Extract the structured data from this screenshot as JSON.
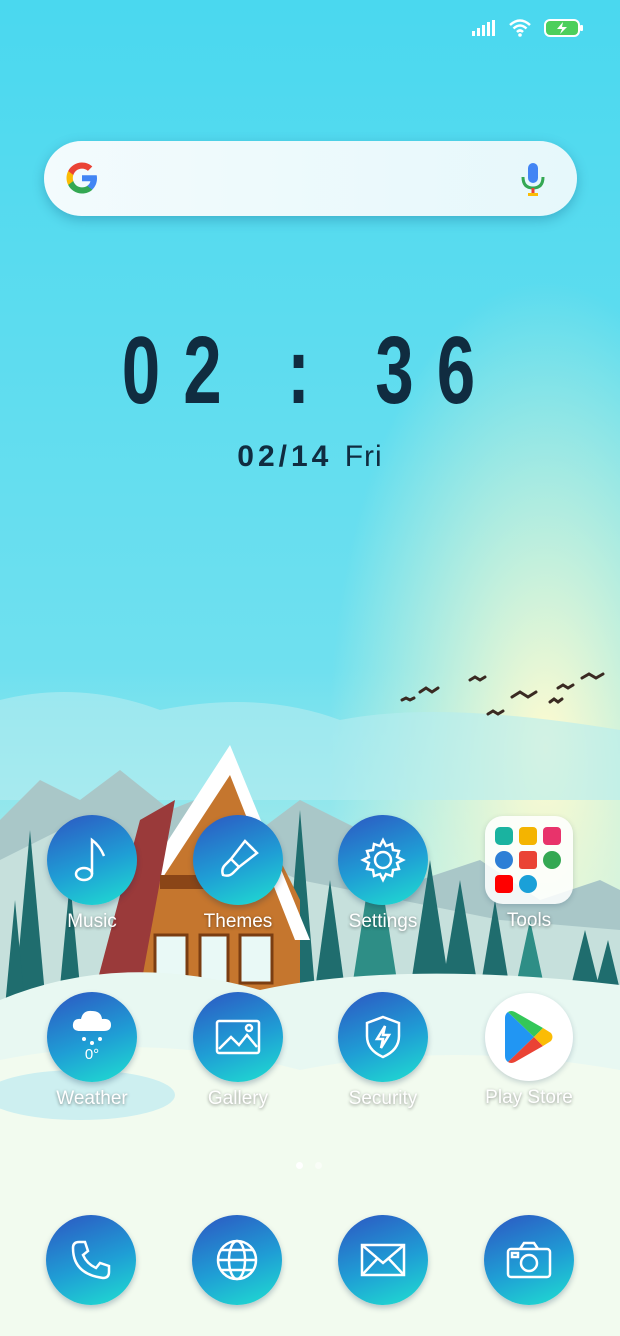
{
  "clock": {
    "time": "02:36",
    "date_num": "02/14",
    "day": "Fri"
  },
  "status": {
    "signal": "signal-bars-icon",
    "wifi": "wifi-icon",
    "battery": "battery-charging-icon"
  },
  "search": {
    "logo": "google-g-icon",
    "mic": "microphone-icon"
  },
  "apps": [
    {
      "label": "Music",
      "icon": "music-note-icon"
    },
    {
      "label": "Themes",
      "icon": "paintbrush-icon"
    },
    {
      "label": "Settings",
      "icon": "gear-icon"
    },
    {
      "label": "Tools",
      "icon": "folder-icon"
    },
    {
      "label": "Weather",
      "icon": "cloud-snow-icon",
      "temp": "0°"
    },
    {
      "label": "Gallery",
      "icon": "image-icon"
    },
    {
      "label": "Security",
      "icon": "shield-bolt-icon"
    },
    {
      "label": "Play Store",
      "icon": "play-store-icon"
    }
  ],
  "dock": [
    {
      "name": "phone",
      "icon": "phone-icon"
    },
    {
      "name": "browser",
      "icon": "globe-icon"
    },
    {
      "name": "messages",
      "icon": "envelope-icon"
    },
    {
      "name": "camera",
      "icon": "camera-icon"
    }
  ],
  "pages": {
    "count": 2,
    "current": 1
  },
  "colors": {
    "sky": "#4fd9ee",
    "clock_text": "#102c40",
    "icon_gradient_top": "#2d56c2",
    "icon_gradient_bottom": "#1fe0d0"
  }
}
